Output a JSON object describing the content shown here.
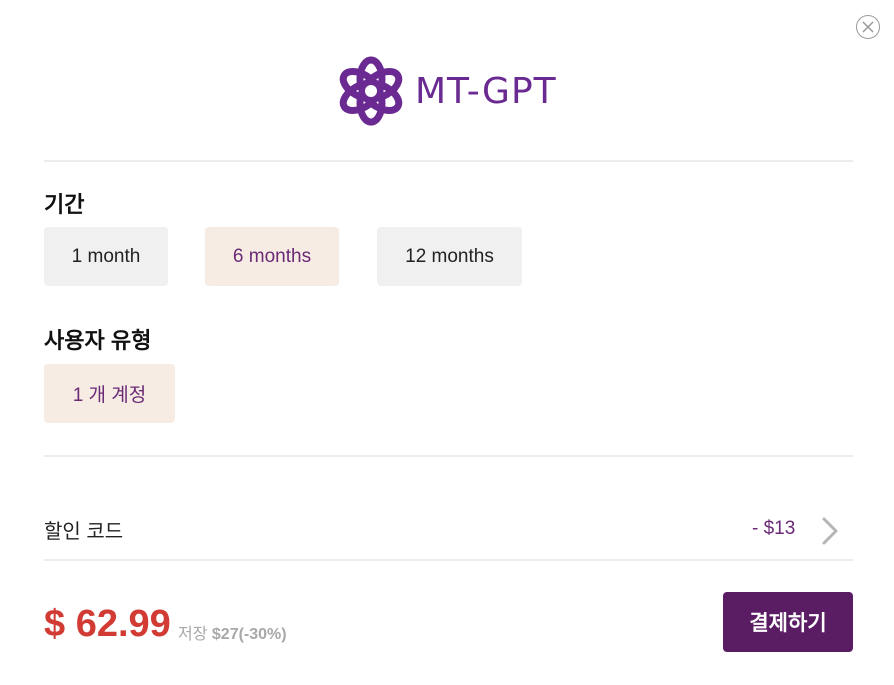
{
  "logo": {
    "text": "MT-GPT",
    "color": "#6a2a92"
  },
  "period": {
    "title": "기간",
    "options": [
      {
        "label": "1 month",
        "selected": false
      },
      {
        "label": "6 months",
        "selected": true
      },
      {
        "label": "12 months",
        "selected": false
      }
    ]
  },
  "user_type": {
    "title": "사용자 유형",
    "options": [
      {
        "label": "1 개 계정",
        "selected": true
      }
    ]
  },
  "discount": {
    "label": "할인 코드",
    "value": "- $13"
  },
  "price": {
    "total": "$ 62.99",
    "save_prefix": "저장",
    "save_amount": "$27(-30%)"
  },
  "checkout": {
    "button_label": "결제하기"
  },
  "colors": {
    "accent": "#5a1d63",
    "price": "#d13b34",
    "selected_bg": "#f6ece3"
  },
  "icons": {
    "close": "close-circle-icon",
    "chevron": "chevron-right-icon"
  }
}
